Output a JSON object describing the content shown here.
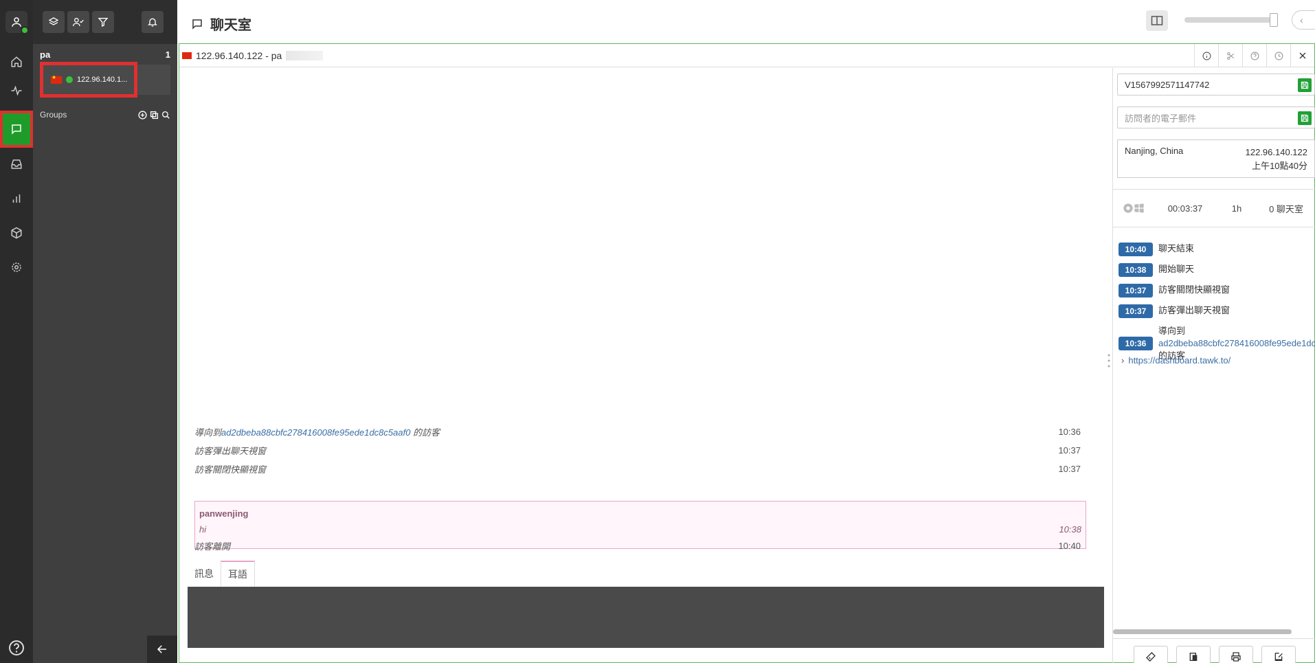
{
  "header": {
    "title": "聊天室"
  },
  "sidebar": {
    "agent_name": "pa",
    "chat_count": "1",
    "chat_item_label": "122.96.140.1...",
    "groups_label": "Groups"
  },
  "tab": {
    "label": "122.96.140.122 - pa"
  },
  "log": [
    {
      "prefix": "導向到",
      "link": "ad2dbeba88cbfc278416008fe95ede1dc8c5aaf0",
      "suffix": " 的訪客",
      "time": "10:36"
    },
    {
      "text": "訪客彈出聊天視窗",
      "time": "10:37"
    },
    {
      "text": "訪客關閉快顯視窗",
      "time": "10:37"
    }
  ],
  "message": {
    "author": "panwenjing",
    "text": "hi",
    "time": "10:38"
  },
  "leave": {
    "text": "訪客離開",
    "time": "10:40"
  },
  "compose": {
    "tab_message": "訊息",
    "tab_whisper": "耳語"
  },
  "visitor": {
    "id": "V1567992571147742",
    "email_placeholder": "訪問者的電子郵件",
    "location": "Nanjing, China",
    "ip": "122.96.140.122",
    "local_time": "上午10點40分",
    "duration": "00:03:37",
    "visits": "1h",
    "chats": "0 聊天室"
  },
  "events": [
    {
      "time": "10:40",
      "text": "聊天結束"
    },
    {
      "time": "10:38",
      "text": "開始聊天"
    },
    {
      "time": "10:37",
      "text": "訪客關閉快顯視窗"
    },
    {
      "time": "10:37",
      "text": "訪客彈出聊天視窗"
    },
    {
      "time": "10:36",
      "prefix": "導向到",
      "link": "ad2dbeba88cbfc278416008fe95ede1dc",
      "suffix": "的訪客"
    }
  ],
  "page_url": "https://dashboard.tawk.to/",
  "colors": {
    "online": "#3cbf3c",
    "accent_green": "#1f9b2a",
    "highlight_red": "#e03030",
    "badge_blue": "#2e6aa8"
  }
}
